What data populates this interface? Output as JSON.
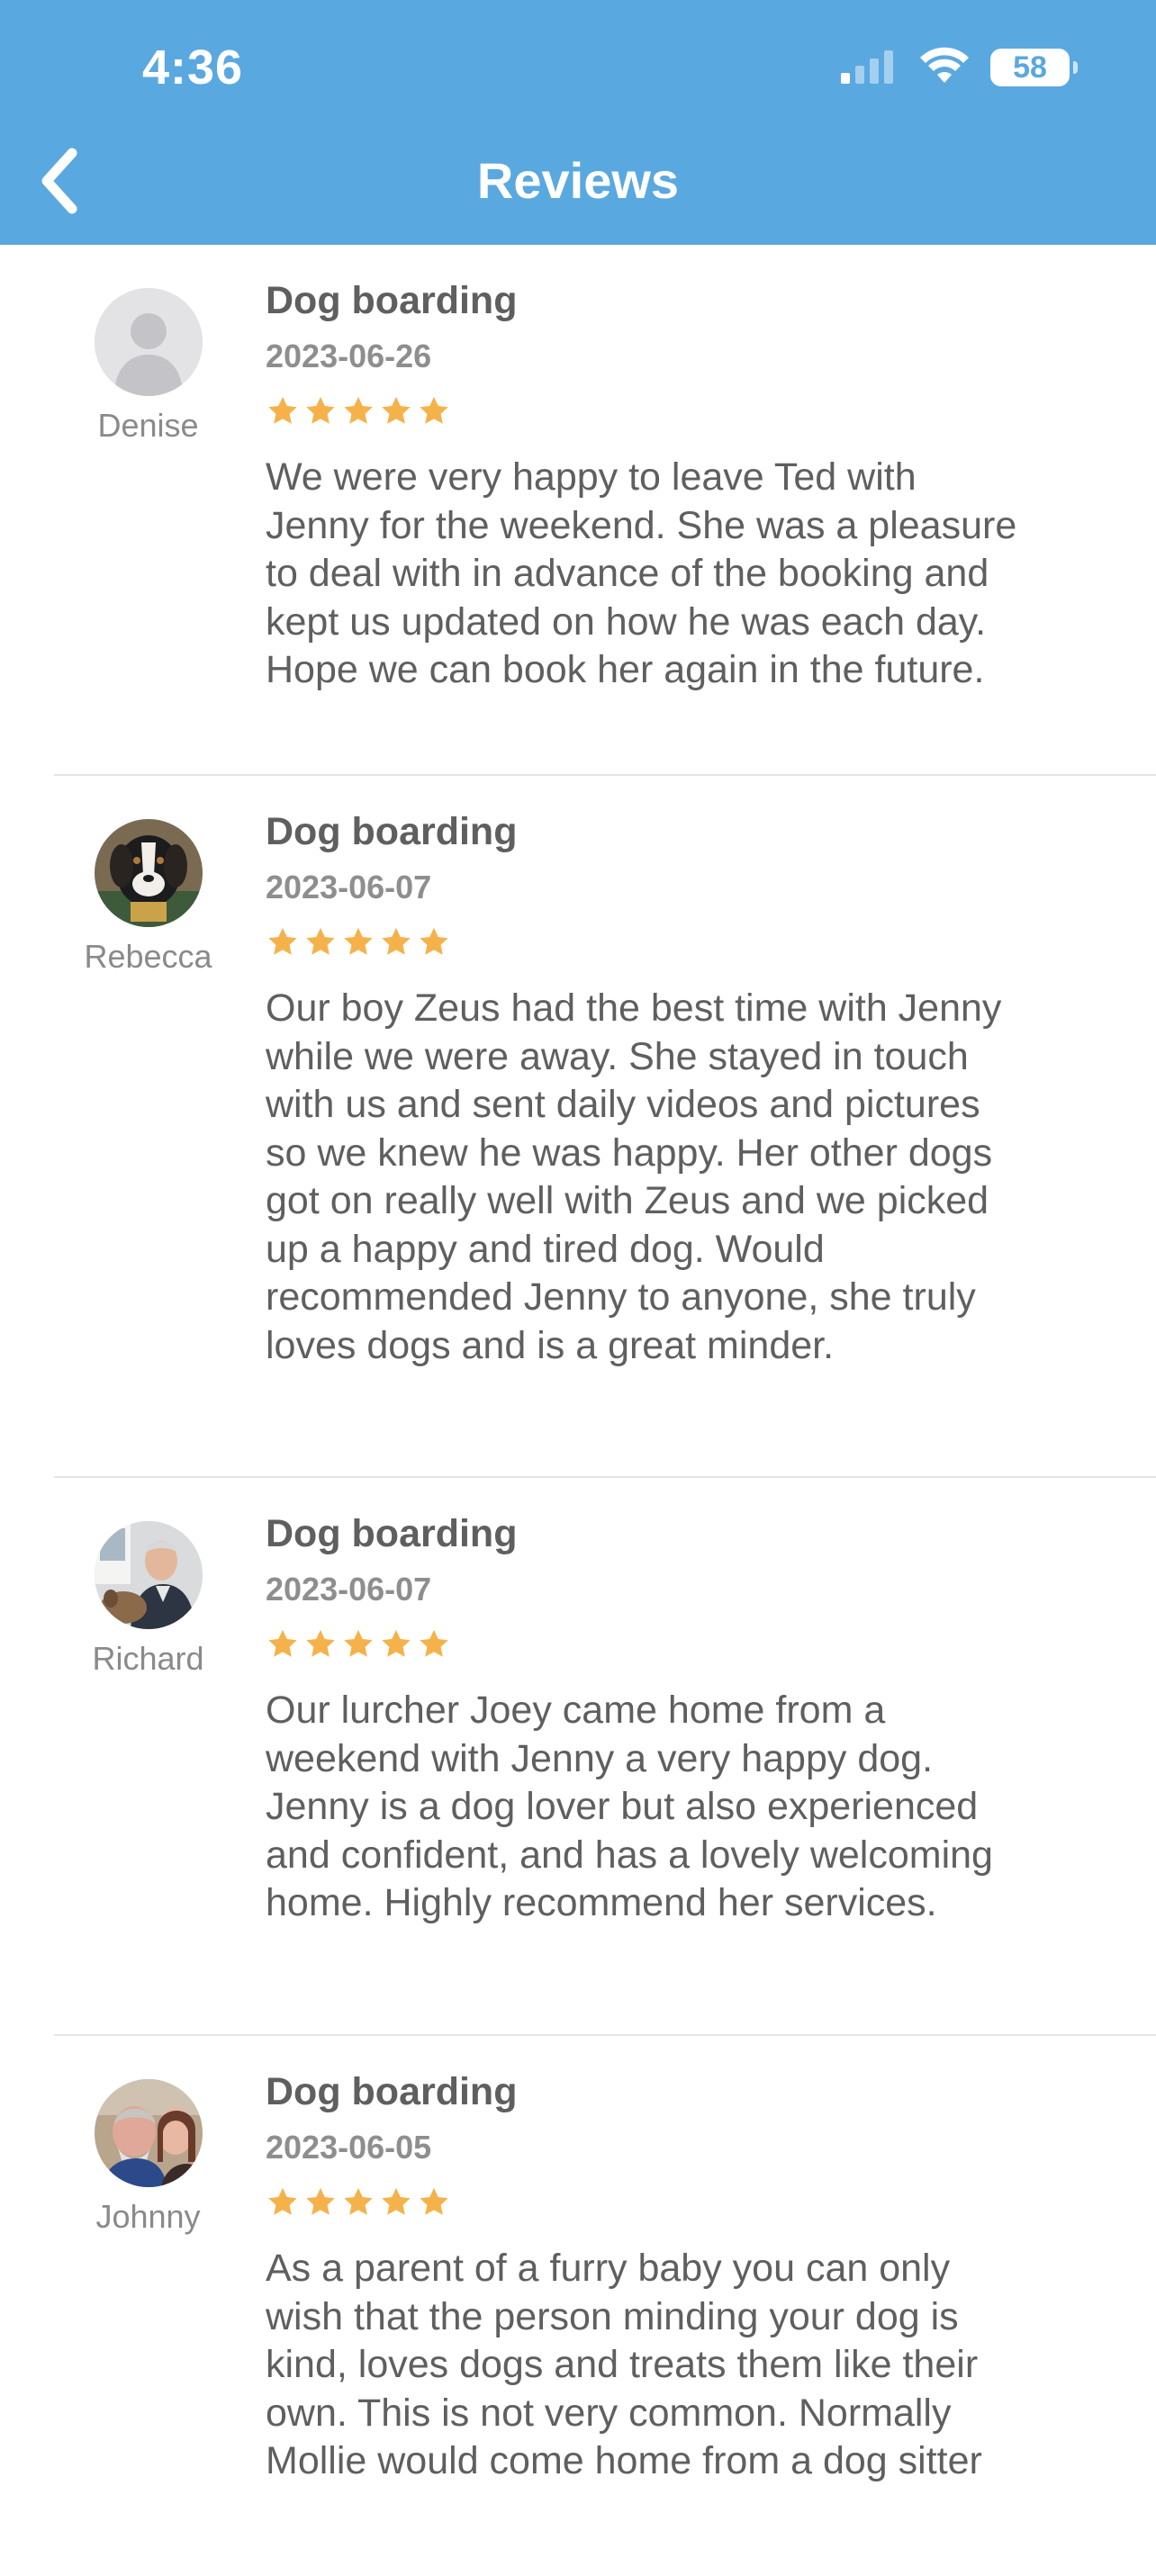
{
  "status_bar": {
    "time": "4:36",
    "battery": "58"
  },
  "header": {
    "title": "Reviews",
    "back_icon": "chevron-left-icon",
    "color": "#5aa8e0"
  },
  "colors": {
    "star": "#f6b24a",
    "header": "#5aa8e0"
  },
  "reviews": [
    {
      "name": "Denise",
      "avatar": "placeholder-person",
      "service": "Dog boarding",
      "date": "2023-06-26",
      "rating": 5,
      "text": "We were very happy to leave Ted with\nJenny for the weekend. She was a pleasure\nto deal with in advance of the booking and\nkept us updated on how he was each day.\nHope we can book her again in the future."
    },
    {
      "name": "Rebecca",
      "avatar": "photo-dog",
      "service": "Dog boarding",
      "date": "2023-06-07",
      "rating": 5,
      "text": "Our boy Zeus had the best time with Jenny\nwhile we were away. She stayed in touch\nwith us and sent daily videos and pictures\nso we knew he was happy. Her other dogs\ngot on really well with Zeus and we picked\nup a happy and tired dog. Would\nrecommended Jenny to anyone, she truly\nloves dogs and is a great minder."
    },
    {
      "name": "Richard",
      "avatar": "photo-man-with-dog",
      "service": "Dog boarding",
      "date": "2023-06-07",
      "rating": 5,
      "text": "Our lurcher Joey came home from a\nweekend with Jenny a very happy dog.\nJenny is a dog lover but also experienced\nand confident, and has a lovely welcoming\nhome. Highly recommend her services."
    },
    {
      "name": "Johnny",
      "avatar": "photo-couple",
      "service": "Dog boarding",
      "date": "2023-06-05",
      "rating": 5,
      "text": "As a parent of a furry baby you can only\nwish that the person minding your dog is\nkind, loves dogs and treats them like their\nown.  This is not very common.  Normally\nMollie would come home from a dog sitter"
    }
  ]
}
